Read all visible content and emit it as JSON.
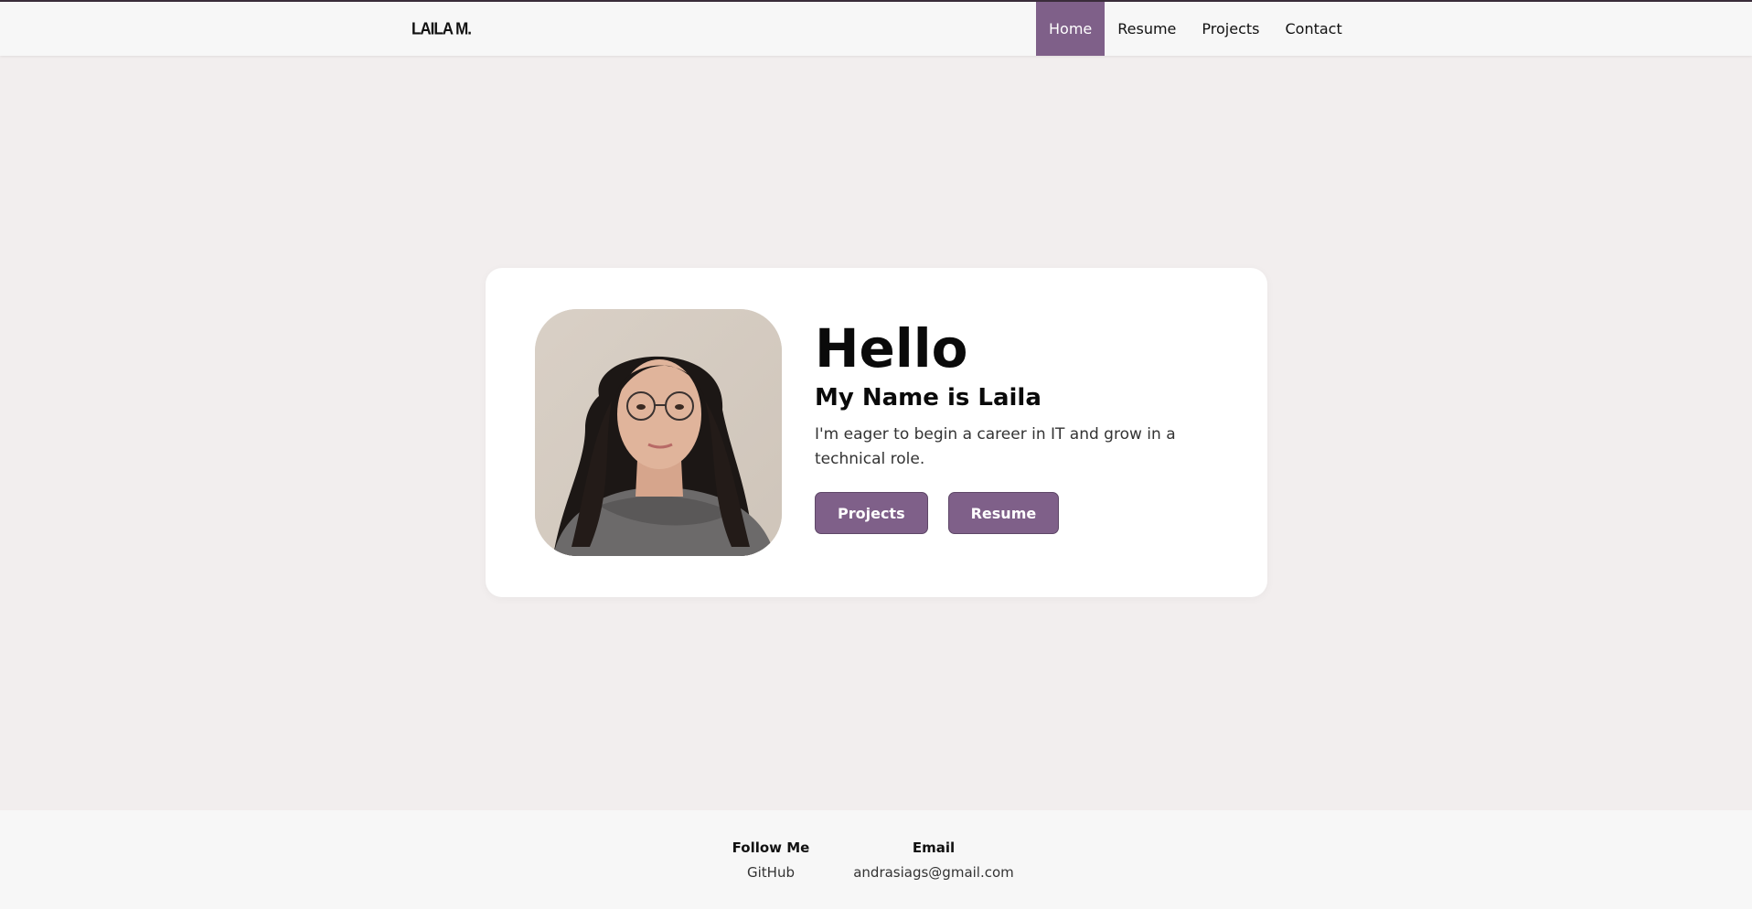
{
  "nav": {
    "brand": "LAILA M.",
    "links": [
      {
        "label": "Home",
        "active": true
      },
      {
        "label": "Resume",
        "active": false
      },
      {
        "label": "Projects",
        "active": false
      },
      {
        "label": "Contact",
        "active": false
      }
    ]
  },
  "hero": {
    "greeting": "Hello",
    "subtitle": "My Name is Laila",
    "description": "I'm eager to begin a career in IT and grow in a technical role.",
    "buttons": {
      "projects": "Projects",
      "resume": "Resume"
    }
  },
  "footer": {
    "follow_title": "Follow Me",
    "follow_link": "GitHub",
    "email_title": "Email",
    "email_value": "andrasiags@gmail.com"
  },
  "colors": {
    "accent": "#7f6089",
    "background": "#f2eeee",
    "card": "#ffffff",
    "bar": "#f7f7f7"
  }
}
